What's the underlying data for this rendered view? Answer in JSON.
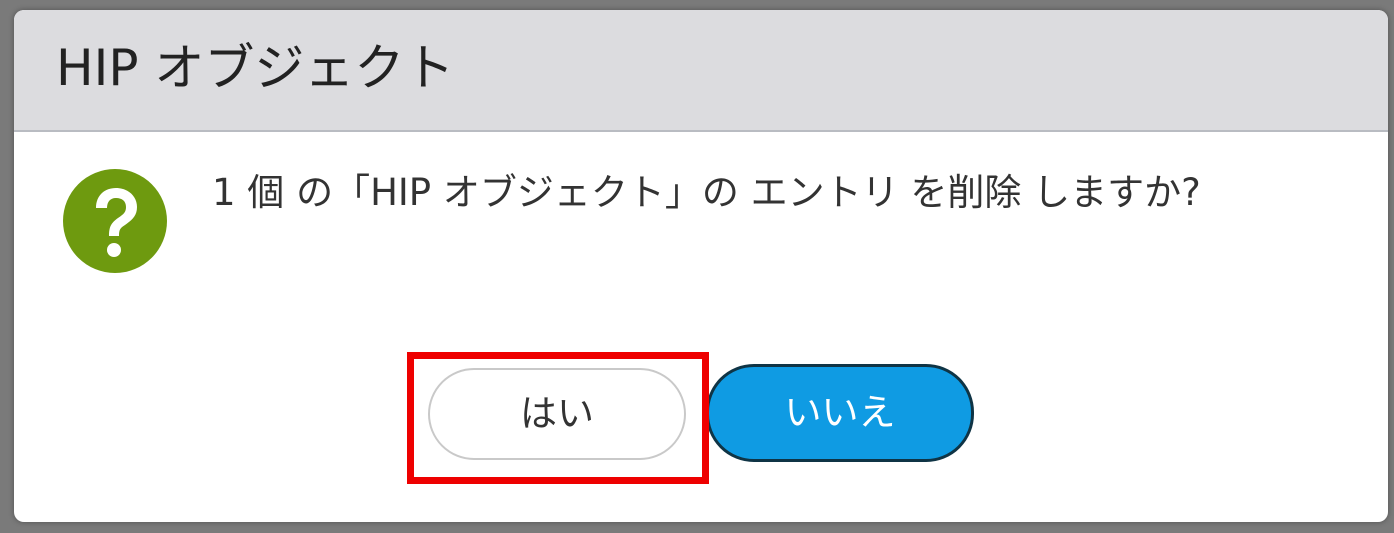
{
  "dialog": {
    "title": "HIP オブジェクト",
    "message": "1 個 の「HIP オブジェクト」の エントリ を削除 しますか?",
    "icon": "question-icon",
    "buttons": {
      "yes_label": "はい",
      "no_label": "いいえ"
    }
  },
  "annotation": {
    "highlight_target": "yes-button",
    "highlight_color": "#ee0000"
  },
  "colors": {
    "header_bg": "#dcdcdf",
    "icon_green": "#6e9a0f",
    "primary_button": "#0f9be3",
    "primary_button_border": "#0f3445"
  }
}
